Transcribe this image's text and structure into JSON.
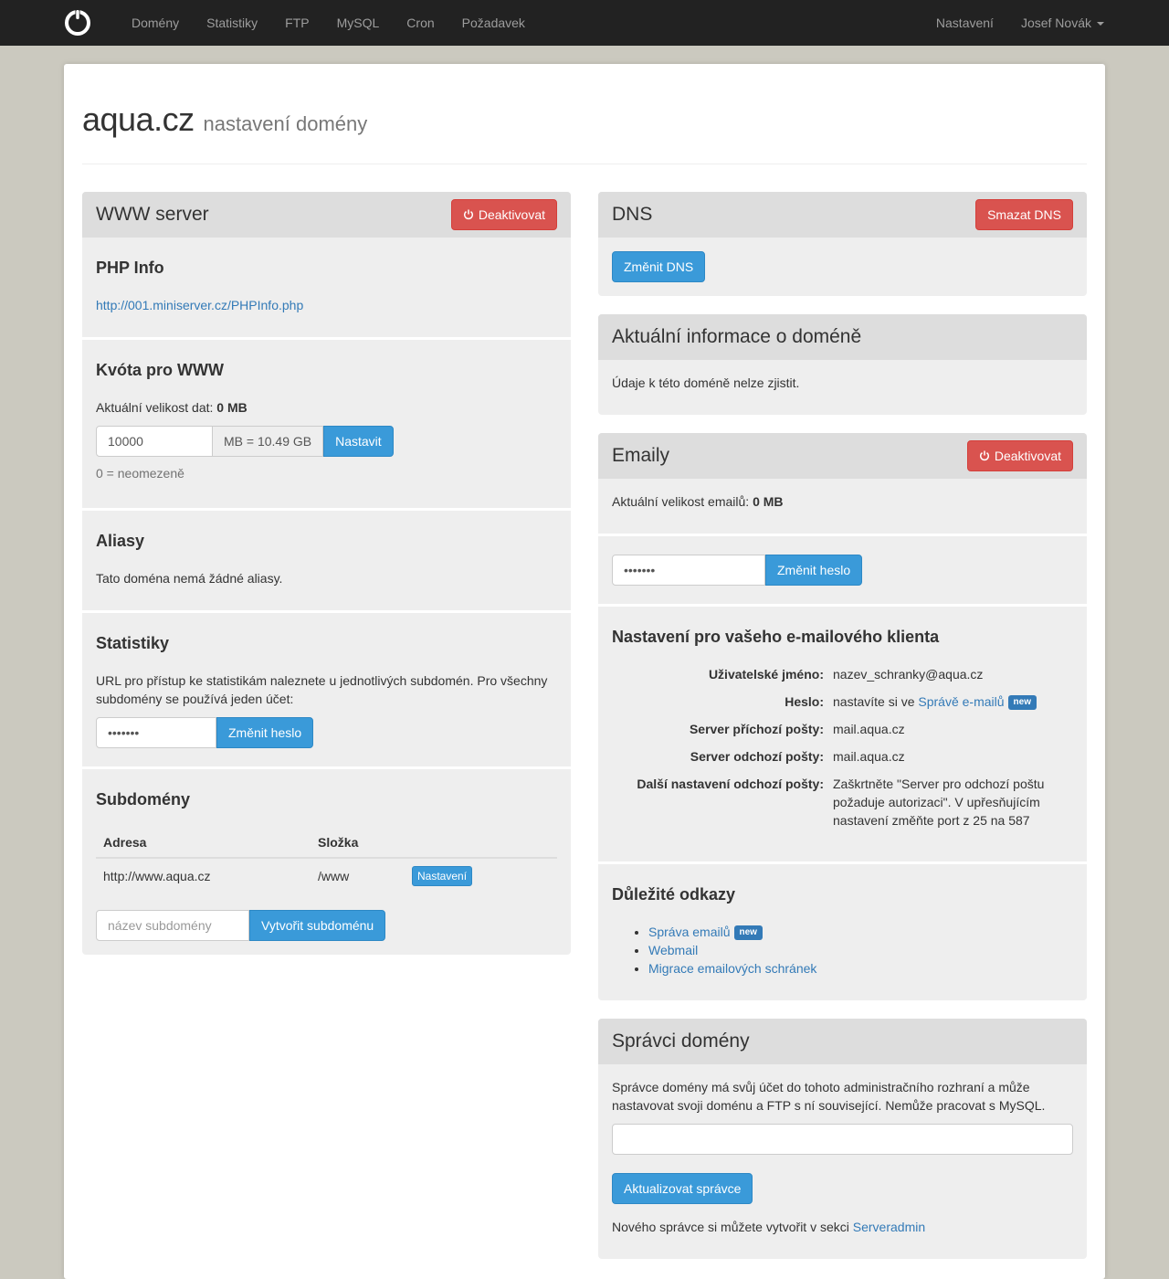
{
  "nav": {
    "items": [
      "Domény",
      "Statistiky",
      "FTP",
      "MySQL",
      "Cron",
      "Požadavek"
    ],
    "settings": "Nastavení",
    "user": "Josef Novák"
  },
  "header": {
    "domain": "aqua.cz",
    "subtitle": "nastavení domény"
  },
  "www": {
    "title": "WWW server",
    "deactivate": "Deaktivovat",
    "phpinfo": {
      "title": "PHP Info",
      "link": "http://001.miniserver.cz/PHPInfo.php"
    },
    "quota": {
      "title": "Kvóta pro WWW",
      "size_label": "Aktuální velikost dat:",
      "size_value": "0 MB",
      "input_value": "10000",
      "addon": "MB = 10.49 GB",
      "set_button": "Nastavit",
      "help": "0 = neomezeně"
    },
    "aliases": {
      "title": "Aliasy",
      "text": "Tato doména nemá žádné aliasy."
    },
    "stats": {
      "title": "Statistiky",
      "text": "URL pro přístup ke statistikám naleznete u jednotlivých subdomén. Pro všechny subdomény se používá jeden účet:",
      "password": "•••••••",
      "button": "Změnit heslo"
    },
    "subdomains": {
      "title": "Subdomény",
      "col_address": "Adresa",
      "col_folder": "Složka",
      "rows": [
        {
          "address": "http://www.aqua.cz",
          "folder": "/www",
          "action": "Nastavení"
        }
      ],
      "placeholder": "název subdomény",
      "create_button": "Vytvořit subdoménu"
    }
  },
  "dns": {
    "title": "DNS",
    "delete_button": "Smazat DNS",
    "change_button": "Změnit DNS"
  },
  "info": {
    "title": "Aktuální informace o doméně",
    "text": "Údaje k této doméně nelze zjistit."
  },
  "emails": {
    "title": "Emaily",
    "deactivate": "Deaktivovat",
    "size_label": "Aktuální velikost emailů:",
    "size_value": "0 MB",
    "password": "•••••••",
    "change_password": "Změnit heslo",
    "client": {
      "title": "Nastavení pro vašeho e-mailového klienta",
      "username_label": "Uživatelské jméno:",
      "username_value": "nazev_schranky@aqua.cz",
      "password_label": "Heslo:",
      "password_text": "nastavíte si ve",
      "password_link": "Správě e-mailů",
      "new_badge": "new",
      "incoming_label": "Server příchozí pošty:",
      "incoming_value": "mail.aqua.cz",
      "outgoing_label": "Server odchozí pošty:",
      "outgoing_value": "mail.aqua.cz",
      "other_label": "Další nastavení odchozí pošty:",
      "other_value": "Zaškrtněte \"Server pro odchozí poštu požaduje autorizaci\". V upřesňujícím nastavení změňte port z 25 na 587"
    },
    "links": {
      "title": "Důležité odkazy",
      "items": [
        "Správa emailů",
        "Webmail",
        "Migrace emailových schránek"
      ],
      "new_badge": "new"
    }
  },
  "admins": {
    "title": "Správci domény",
    "text": "Správce domény má svůj účet do tohoto administračního rozhraní a může nastavovat svoji doménu a FTP s ní související. Nemůže pracovat s MySQL.",
    "input_value": "",
    "button": "Aktualizovat správce",
    "footer_text": "Nového správce si můžete vytvořit v sekci",
    "footer_link": "Serveradmin"
  }
}
